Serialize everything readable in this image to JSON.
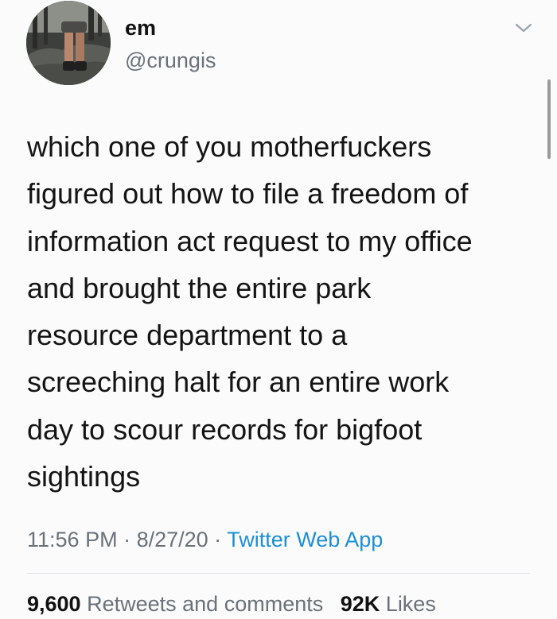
{
  "user": {
    "display_name": "em",
    "handle": "@crungis",
    "avatar_icon": "profile-photo-legs-on-rock"
  },
  "tweet": {
    "text": "which one of you motherfuckers\nfigured out how to file a freedom of\ninformation act request to my office\nand brought the entire park\nresource department to a\nscreeching halt for an entire work\nday to scour records for bigfoot\nsightings"
  },
  "meta": {
    "time": "11:56 PM",
    "separator1": " · ",
    "date": "8/27/20",
    "separator2": " · ",
    "source": "Twitter Web App"
  },
  "stats": {
    "retweets_count": "9,600",
    "retweets_label": "Retweets and comments",
    "likes_count": "92K",
    "likes_label": "Likes"
  },
  "icons": {
    "menu": "chevron-down-icon"
  },
  "colors": {
    "link": "#1d8fd6",
    "secondary_text": "#6a7178",
    "primary_text": "#141414"
  }
}
